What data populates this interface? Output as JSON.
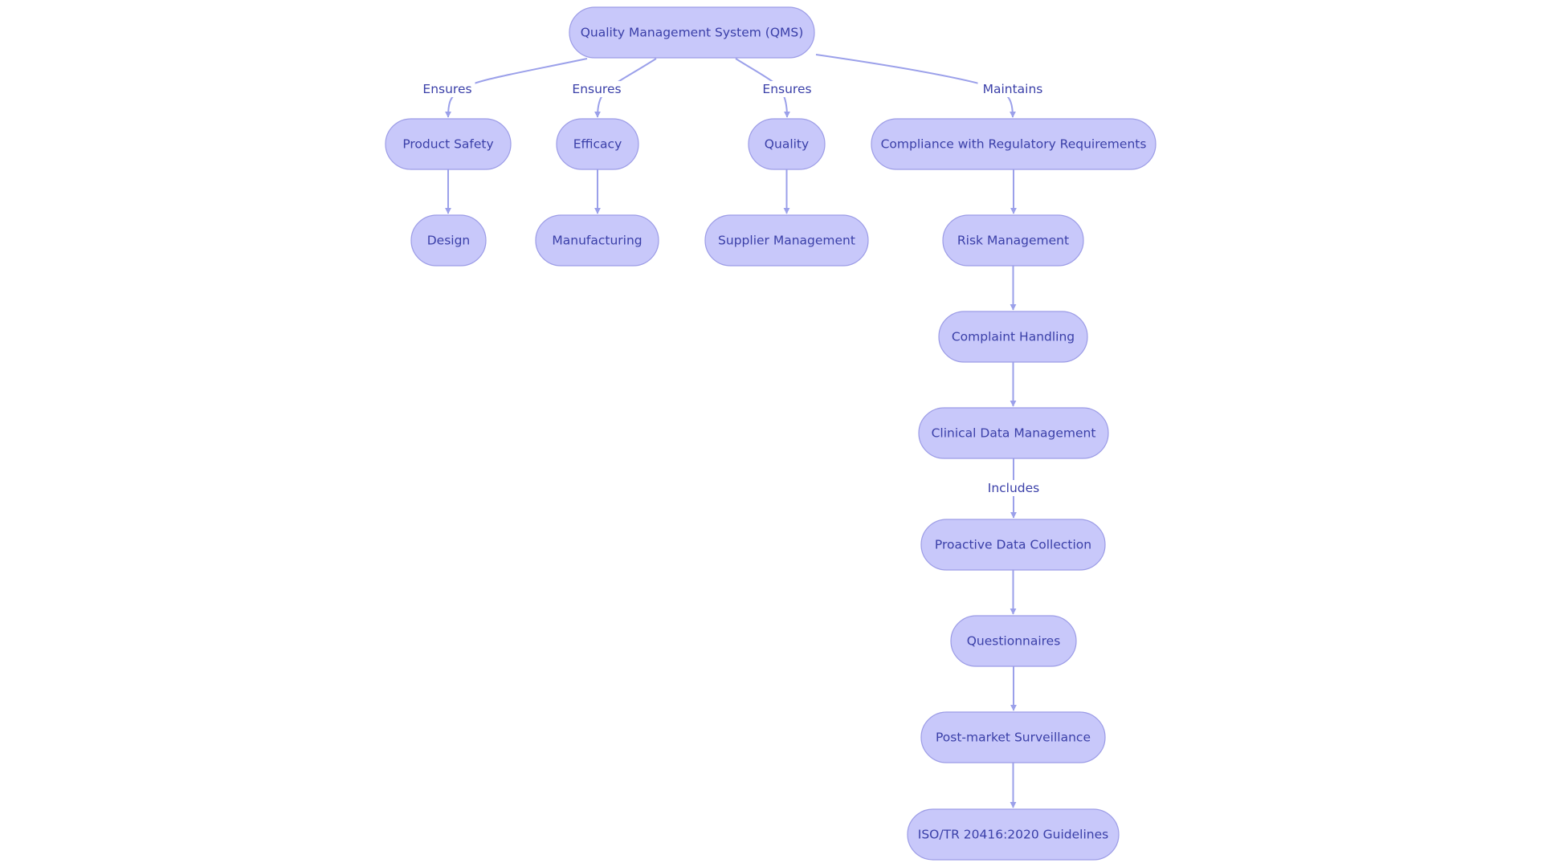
{
  "diagram": {
    "type": "flowchart",
    "colors": {
      "node_fill": "#c8c8fa",
      "node_border": "#9c9ce6",
      "text": "#3a3fa8",
      "edge": "#9ba0ea",
      "background": "#ffffff"
    },
    "nodes": [
      {
        "id": "qms",
        "label": "Quality Management System (QMS)"
      },
      {
        "id": "product_safety",
        "label": "Product Safety"
      },
      {
        "id": "efficacy",
        "label": "Efficacy"
      },
      {
        "id": "quality",
        "label": "Quality"
      },
      {
        "id": "compliance",
        "label": "Compliance with Regulatory Requirements"
      },
      {
        "id": "design",
        "label": "Design"
      },
      {
        "id": "manufacturing",
        "label": "Manufacturing"
      },
      {
        "id": "supplier_management",
        "label": "Supplier Management"
      },
      {
        "id": "risk_management",
        "label": "Risk Management"
      },
      {
        "id": "complaint_handling",
        "label": "Complaint Handling"
      },
      {
        "id": "clinical_data_management",
        "label": "Clinical Data Management"
      },
      {
        "id": "proactive_data_collection",
        "label": "Proactive Data Collection"
      },
      {
        "id": "questionnaires",
        "label": "Questionnaires"
      },
      {
        "id": "post_market_surveillance",
        "label": "Post-market Surveillance"
      },
      {
        "id": "iso_guidelines",
        "label": "ISO/TR 20416:2020 Guidelines"
      }
    ],
    "edges": [
      {
        "from": "qms",
        "to": "product_safety",
        "label": "Ensures"
      },
      {
        "from": "qms",
        "to": "efficacy",
        "label": "Ensures"
      },
      {
        "from": "qms",
        "to": "quality",
        "label": "Ensures"
      },
      {
        "from": "qms",
        "to": "compliance",
        "label": "Maintains"
      },
      {
        "from": "product_safety",
        "to": "design",
        "label": ""
      },
      {
        "from": "efficacy",
        "to": "manufacturing",
        "label": ""
      },
      {
        "from": "quality",
        "to": "supplier_management",
        "label": ""
      },
      {
        "from": "compliance",
        "to": "risk_management",
        "label": ""
      },
      {
        "from": "risk_management",
        "to": "complaint_handling",
        "label": ""
      },
      {
        "from": "complaint_handling",
        "to": "clinical_data_management",
        "label": ""
      },
      {
        "from": "clinical_data_management",
        "to": "proactive_data_collection",
        "label": "Includes"
      },
      {
        "from": "proactive_data_collection",
        "to": "questionnaires",
        "label": ""
      },
      {
        "from": "questionnaires",
        "to": "post_market_surveillance",
        "label": ""
      },
      {
        "from": "post_market_surveillance",
        "to": "iso_guidelines",
        "label": ""
      }
    ]
  }
}
